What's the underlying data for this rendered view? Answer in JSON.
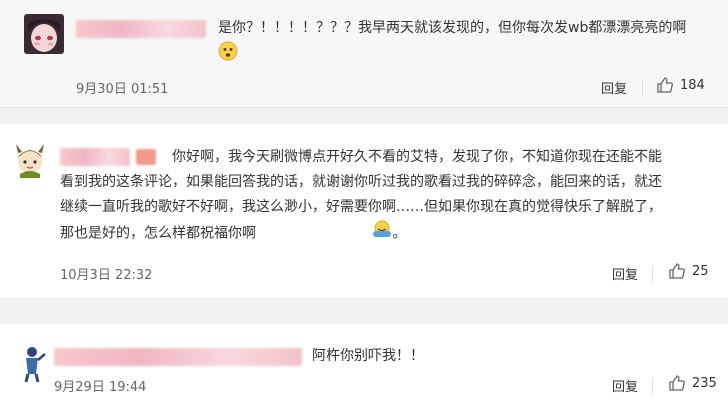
{
  "comments": [
    {
      "text_line1": "是你？！！！！？？？我早两天就该发现的，但你每次发wb都漂漂亮亮的啊",
      "time": "9月30日 01:51",
      "reply_label": "回复",
      "likes": "184"
    },
    {
      "text_lines": [
        "你好啊，我今天刷微博点开好久不看的艾特，发现了你，不知道你现在还能不能",
        "看到我的这条评论，如果能回答我的话，就谢谢你听过我的歌看过我的碎碎念，能回来的话，就还",
        "继续一直听我的歌好不好啊，我这么渺小，好需要你啊……但如果你现在真的觉得快乐了解脱了，",
        "那也是好的，怎么样都祝福你啊"
      ],
      "text_tail": "。",
      "time": "10月3日 22:32",
      "reply_label": "回复",
      "likes": "25"
    },
    {
      "text_line1": "阿杵你别吓我！！",
      "time": "9月29日 19:44",
      "reply_label": "回复",
      "likes": "235"
    }
  ]
}
